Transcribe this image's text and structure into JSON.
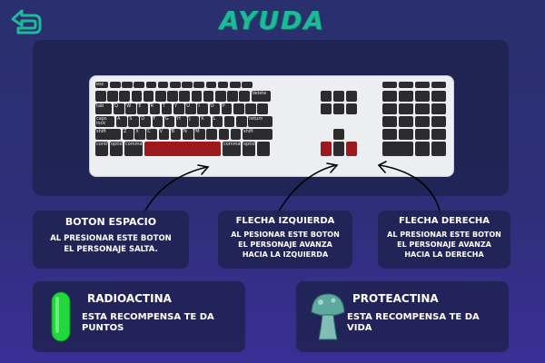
{
  "screen_title": "AYUDA",
  "back_button": {
    "icon": "return-arrow-icon"
  },
  "keyboard": {
    "space_highlight_color": "#9c1a1e",
    "left_arrow_highlighted": true,
    "right_arrow_highlighted": true,
    "labels": {
      "tab": "tab",
      "caps_lock": "caps lock",
      "shift": "shift",
      "control": "control",
      "option": "option",
      "command": "command",
      "return": "return",
      "delete": "delete",
      "esc": "esc",
      "letters_row1": [
        "Q",
        "W",
        "E",
        "R",
        "T",
        "Y",
        "U",
        "I",
        "O",
        "P"
      ],
      "letters_row2": [
        "A",
        "S",
        "D",
        "F",
        "G",
        "H",
        "J",
        "K",
        "L"
      ],
      "letters_row3": [
        "Z",
        "X",
        "C",
        "V",
        "B",
        "N",
        "M"
      ]
    }
  },
  "instructions": {
    "space": {
      "title": "BOTON ESPACIO",
      "text_line1": "AL PRESIONAR ESTE BOTON",
      "text_line2": "EL PERSONAJE SALTA."
    },
    "left": {
      "title": "FLECHA IZQUIERDA",
      "text_line1": "AL PESIONAR ESTE BOTON",
      "text_line2": "EL PERSONAJE AVANZA",
      "text_line3": "HACIA LA IZQUIERDA"
    },
    "right": {
      "title": "FLECHA DERECHA",
      "text_line1": "AL PRESIONAR ESTE BOTON",
      "text_line2": "EL PERSONAJE AVANZA",
      "text_line3": "HACIA LA DERECHA"
    }
  },
  "rewards": {
    "radioactina": {
      "title": "RADIOACTINA",
      "text_line1": "ESTA RECOMPENSA TE DA",
      "text_line2": "PUNTOS",
      "icon": "green-capsule-icon",
      "color": "#22d83a"
    },
    "proteactina": {
      "title": "PROTEACTINA",
      "text_line1": "ESTA RECOMPENSA TE DA",
      "text_line2": "VIDA",
      "icon": "teal-mushroom-icon",
      "color": "#5fa8a0"
    }
  }
}
